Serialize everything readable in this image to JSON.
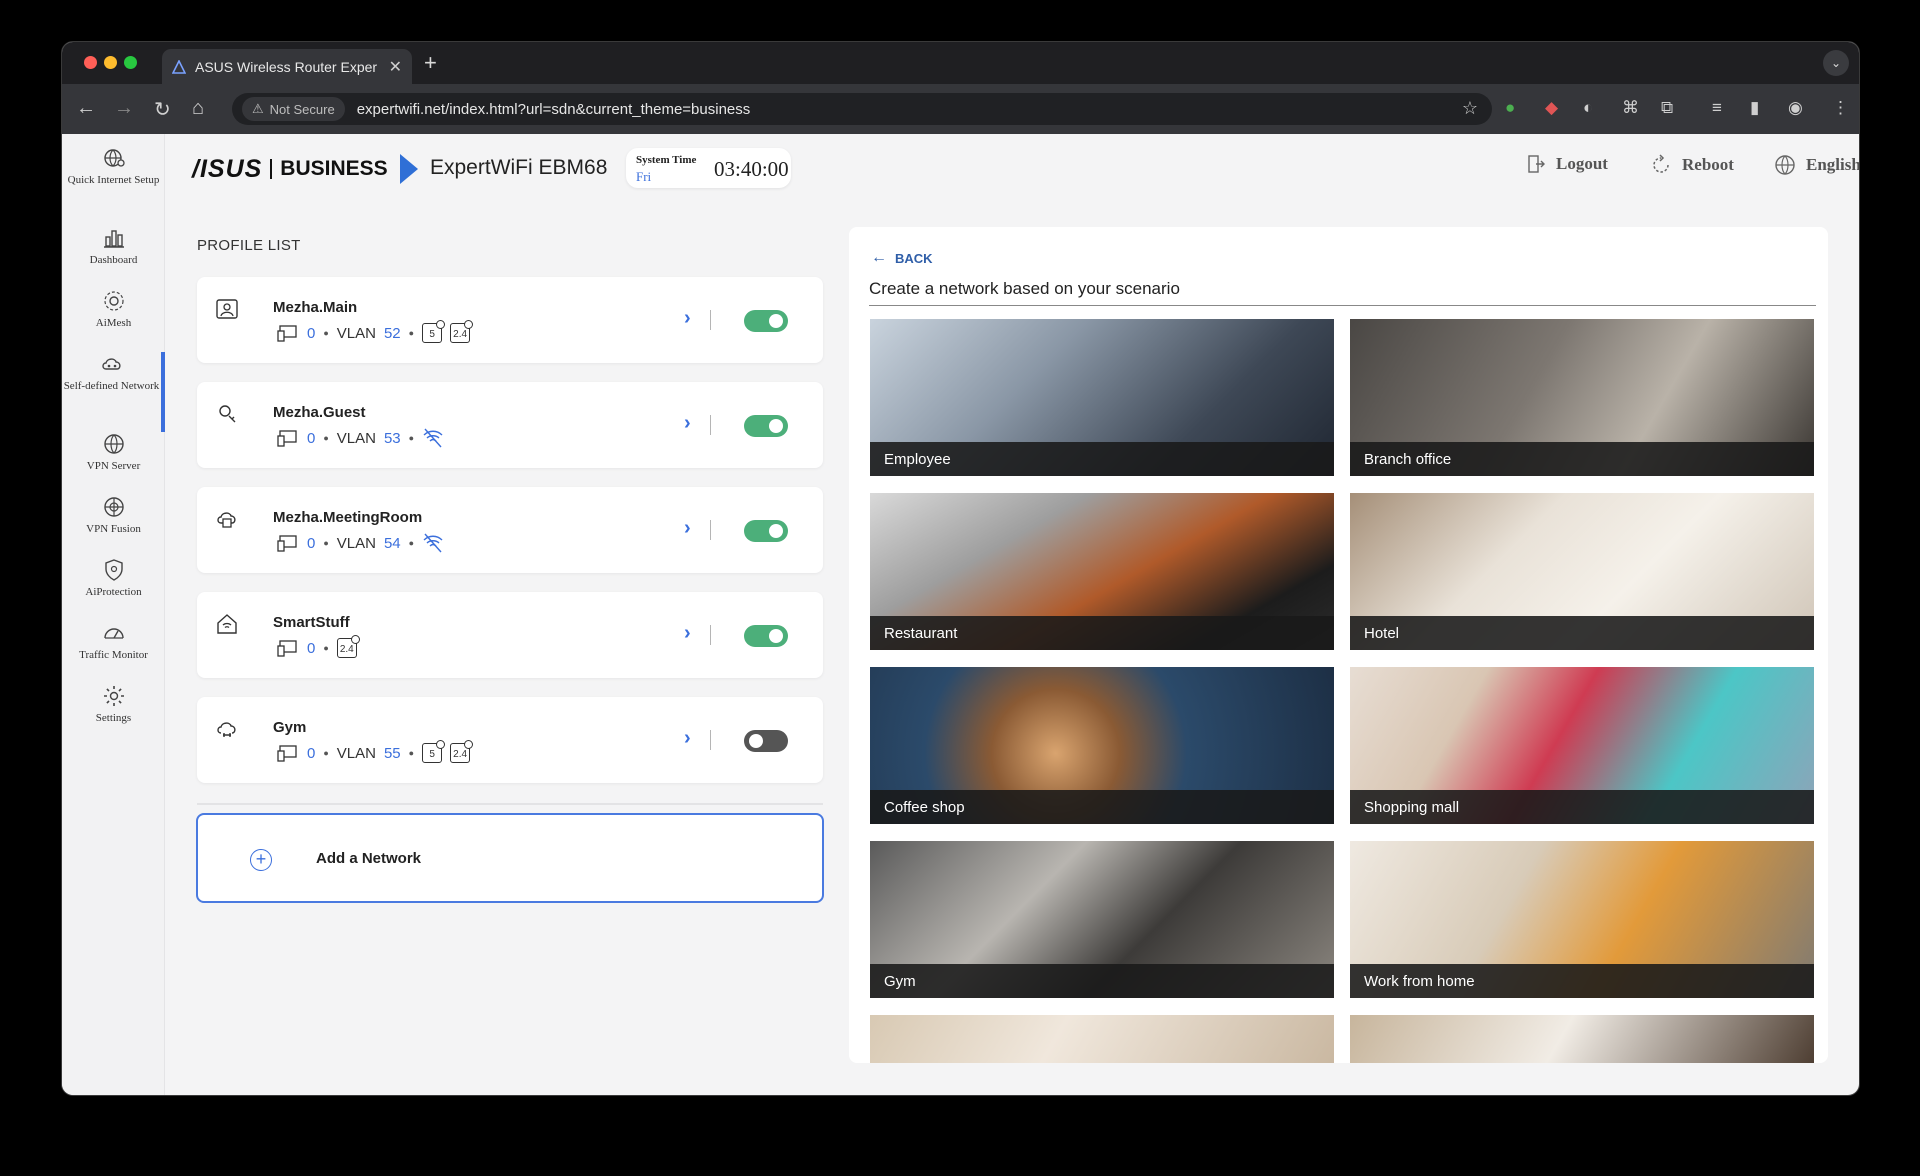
{
  "browser": {
    "tab_title": "ASUS Wireless Router Exper",
    "security": "Not Secure",
    "url": "expertwifi.net/index.html?url=sdn&current_theme=business"
  },
  "sidebar": {
    "items": [
      {
        "label": "Quick Internet Setup",
        "icon": "globe-gear-icon"
      },
      {
        "label": "Dashboard",
        "icon": "bar-chart-icon"
      },
      {
        "label": "AiMesh",
        "icon": "mesh-icon"
      },
      {
        "label": "Self-defined Network",
        "icon": "cloud-network-icon"
      },
      {
        "label": "VPN Server",
        "icon": "vpn-globe-icon"
      },
      {
        "label": "VPN Fusion",
        "icon": "vpn-fusion-icon"
      },
      {
        "label": "AiProtection",
        "icon": "shield-icon"
      },
      {
        "label": "Traffic Monitor",
        "icon": "gauge-icon"
      },
      {
        "label": "Settings",
        "icon": "gear-icon"
      }
    ],
    "active": "Self-defined Network"
  },
  "header": {
    "brand": "/ISUS",
    "brand_sub": "BUSINESS",
    "model": "ExpertWiFi EBM68",
    "system_time_label": "System Time",
    "day": "Fri",
    "time": "03:40:00",
    "logout": "Logout",
    "reboot": "Reboot",
    "language": "English"
  },
  "profile_list": {
    "title": "PROFILE LIST",
    "profiles": [
      {
        "name": "Mezha.Main",
        "devices": "0",
        "vlan_label": "VLAN",
        "vlan": "52",
        "bands": [
          "5",
          "2.4"
        ],
        "enabled": true
      },
      {
        "name": "Mezha.Guest",
        "devices": "0",
        "vlan_label": "VLAN",
        "vlan": "53",
        "bands": [],
        "enabled": true
      },
      {
        "name": "Mezha.MeetingRoom",
        "devices": "0",
        "vlan_label": "VLAN",
        "vlan": "54",
        "bands": [],
        "enabled": true
      },
      {
        "name": "SmartStuff",
        "devices": "0",
        "vlan_label": "",
        "vlan": "",
        "bands": [
          "2.4"
        ],
        "enabled": true
      },
      {
        "name": "Gym",
        "devices": "0",
        "vlan_label": "VLAN",
        "vlan": "55",
        "bands": [
          "5",
          "2.4"
        ],
        "enabled": false
      }
    ],
    "add_label": "Add a Network"
  },
  "scenario": {
    "back_label": "BACK",
    "title": "Create a network based on your scenario",
    "tiles": [
      "Employee",
      "Branch office",
      "Restaurant",
      "Hotel",
      "Coffee shop",
      "Shopping mall",
      "Gym",
      "Work from home"
    ]
  },
  "colors": {
    "accent": "#3b6fdc",
    "toggle_on": "#4caf7a",
    "toggle_off": "#555555"
  }
}
